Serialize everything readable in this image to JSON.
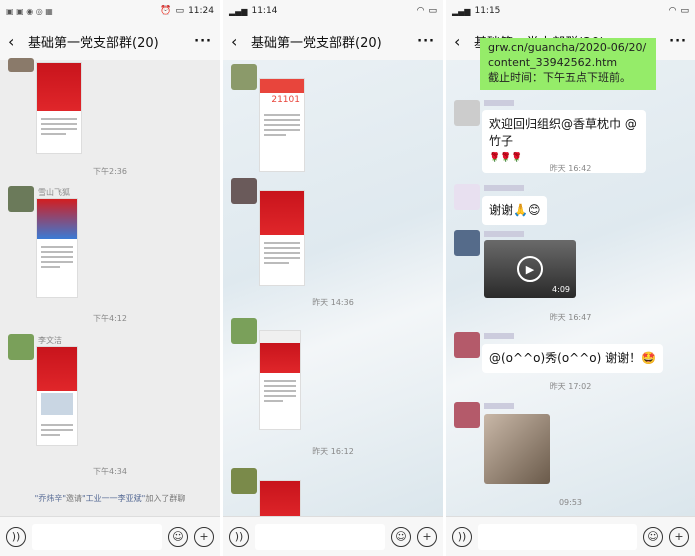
{
  "panel1": {
    "status_time": "11:24",
    "title": "基础第一党支部群(20)",
    "times": [
      "下午2:36",
      "下午4:12",
      "下午4:34"
    ],
    "nicks": [
      "雪山飞狐",
      "李文洁"
    ],
    "sys": {
      "a": "\"乔炜辛\"",
      "b": "邀请",
      "c": "\"工业一一李亚斌\"",
      "d": "加入了群聊"
    }
  },
  "panel2": {
    "status_time": "11:14",
    "title": "基础第一党支部群(20)",
    "times": [
      "昨天 14:36",
      "昨天 16:12"
    ],
    "score": "21101"
  },
  "panel3": {
    "status_time": "11:15",
    "title": "基础第一党支部群(20)",
    "green_text": "grw.cn/guancha/2020-06/20/content_33942562.htm",
    "green_text2": "截止时间：下午五点下班前。",
    "msg1": "欢迎回归组织@香草枕巾 @竹子",
    "msg1_emoji": "🌹🌹🌹",
    "time1": "昨天 16:42",
    "msg2": "谢谢🙏😊",
    "video_duration": "4:09",
    "time2": "昨天 16:47",
    "msg3": "@(o^^o)秀(o^^o) 谢谢！🤩",
    "time3": "昨天 17:02",
    "time4": "09:53"
  },
  "icons": {
    "back": "chevron-left-icon",
    "more": "more-icon",
    "voice": "voice-icon",
    "emoji": "emoji-icon",
    "plus": "plus-icon"
  }
}
